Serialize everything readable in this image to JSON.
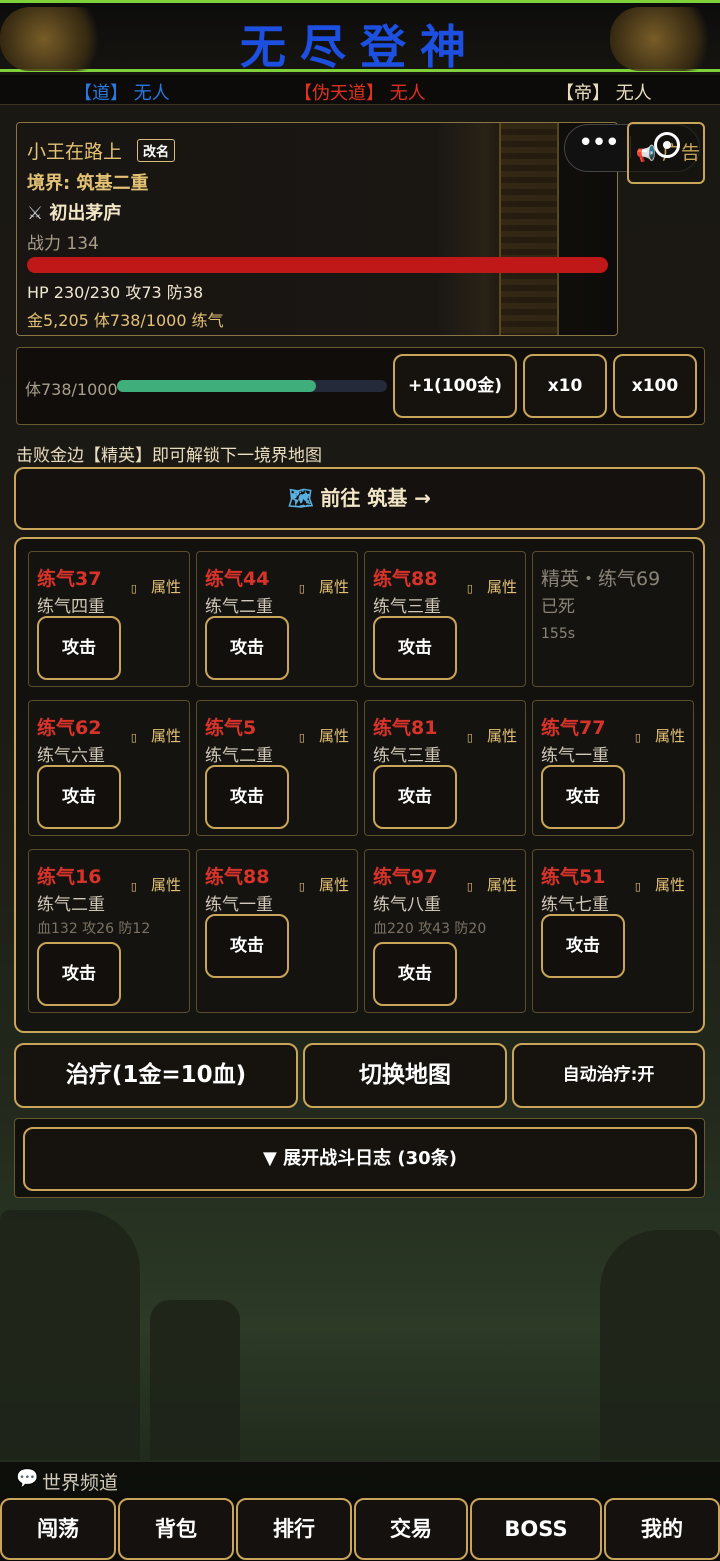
{
  "app": {
    "title": "无尽登神"
  },
  "rulers": [
    {
      "bracket": "【道】",
      "name": "无人",
      "color": "#2a78e0"
    },
    {
      "bracket": "【伪天道】",
      "name": "无人",
      "color": "#e03020"
    },
    {
      "bracket": "【帝】",
      "name": "无人",
      "color": "#e8dcc0"
    }
  ],
  "player": {
    "name": "小王在路上",
    "rename_label": "改名",
    "realm": "境界: 筑基二重",
    "title_tag": "初出茅庐",
    "power": "战力 134",
    "hp_fraction": 1.0,
    "stats_line": "HP 230/230 攻73 防38",
    "resources_line": "金5,205 体738/1000 练气"
  },
  "ad_button": {
    "label": "广告"
  },
  "training": {
    "label": "体738/1000",
    "progress": 0.738,
    "buttons": {
      "plus_one": "+1(100金)",
      "x10": "x10",
      "x100": "x100"
    }
  },
  "hint": "击败金边【精英】即可解锁下一境界地图",
  "go_map_button": "前往 筑基 →",
  "monsters": [
    {
      "name": "练气37",
      "realm": "练气四重",
      "attr": "属性",
      "stats": "",
      "attack": "攻击",
      "dead": false
    },
    {
      "name": "练气44",
      "realm": "练气二重",
      "attr": "属性",
      "stats": "",
      "attack": "攻击",
      "dead": false
    },
    {
      "name": "练气88",
      "realm": "练气三重",
      "attr": "属性",
      "stats": "",
      "attack": "攻击",
      "dead": false
    },
    {
      "name": "精英・练气69",
      "realm": "已死",
      "timer": "155s",
      "dead": true
    },
    {
      "name": "练气62",
      "realm": "练气六重",
      "attr": "属性",
      "stats": "",
      "attack": "攻击",
      "dead": false
    },
    {
      "name": "练气5",
      "realm": "练气二重",
      "attr": "属性",
      "stats": "",
      "attack": "攻击",
      "dead": false
    },
    {
      "name": "练气81",
      "realm": "练气三重",
      "attr": "属性",
      "stats": "",
      "attack": "攻击",
      "dead": false
    },
    {
      "name": "练气77",
      "realm": "练气一重",
      "attr": "属性",
      "stats": "",
      "attack": "攻击",
      "dead": false
    },
    {
      "name": "练气16",
      "realm": "练气二重",
      "attr": "属性",
      "stats": "血132 攻26 防12",
      "attack": "攻击",
      "dead": false
    },
    {
      "name": "练气88",
      "realm": "练气一重",
      "attr": "属性",
      "stats": "",
      "attack": "攻击",
      "dead": false
    },
    {
      "name": "练气97",
      "realm": "练气八重",
      "attr": "属性",
      "stats": "血220 攻43 防20",
      "attack": "攻击",
      "dead": false
    },
    {
      "name": "练气51",
      "realm": "练气七重",
      "attr": "属性",
      "stats": "",
      "attack": "攻击",
      "dead": false
    }
  ],
  "actions": {
    "heal": "治疗(1金=10血)",
    "switch_map": "切换地图",
    "auto_heal": "自动治疗:开"
  },
  "battle_log_button": "▼ 展开战斗日志 (30条)",
  "world_chat": {
    "label": "世界频道"
  },
  "nav": [
    "闯荡",
    "背包",
    "排行",
    "交易",
    "BOSS",
    "我的"
  ]
}
